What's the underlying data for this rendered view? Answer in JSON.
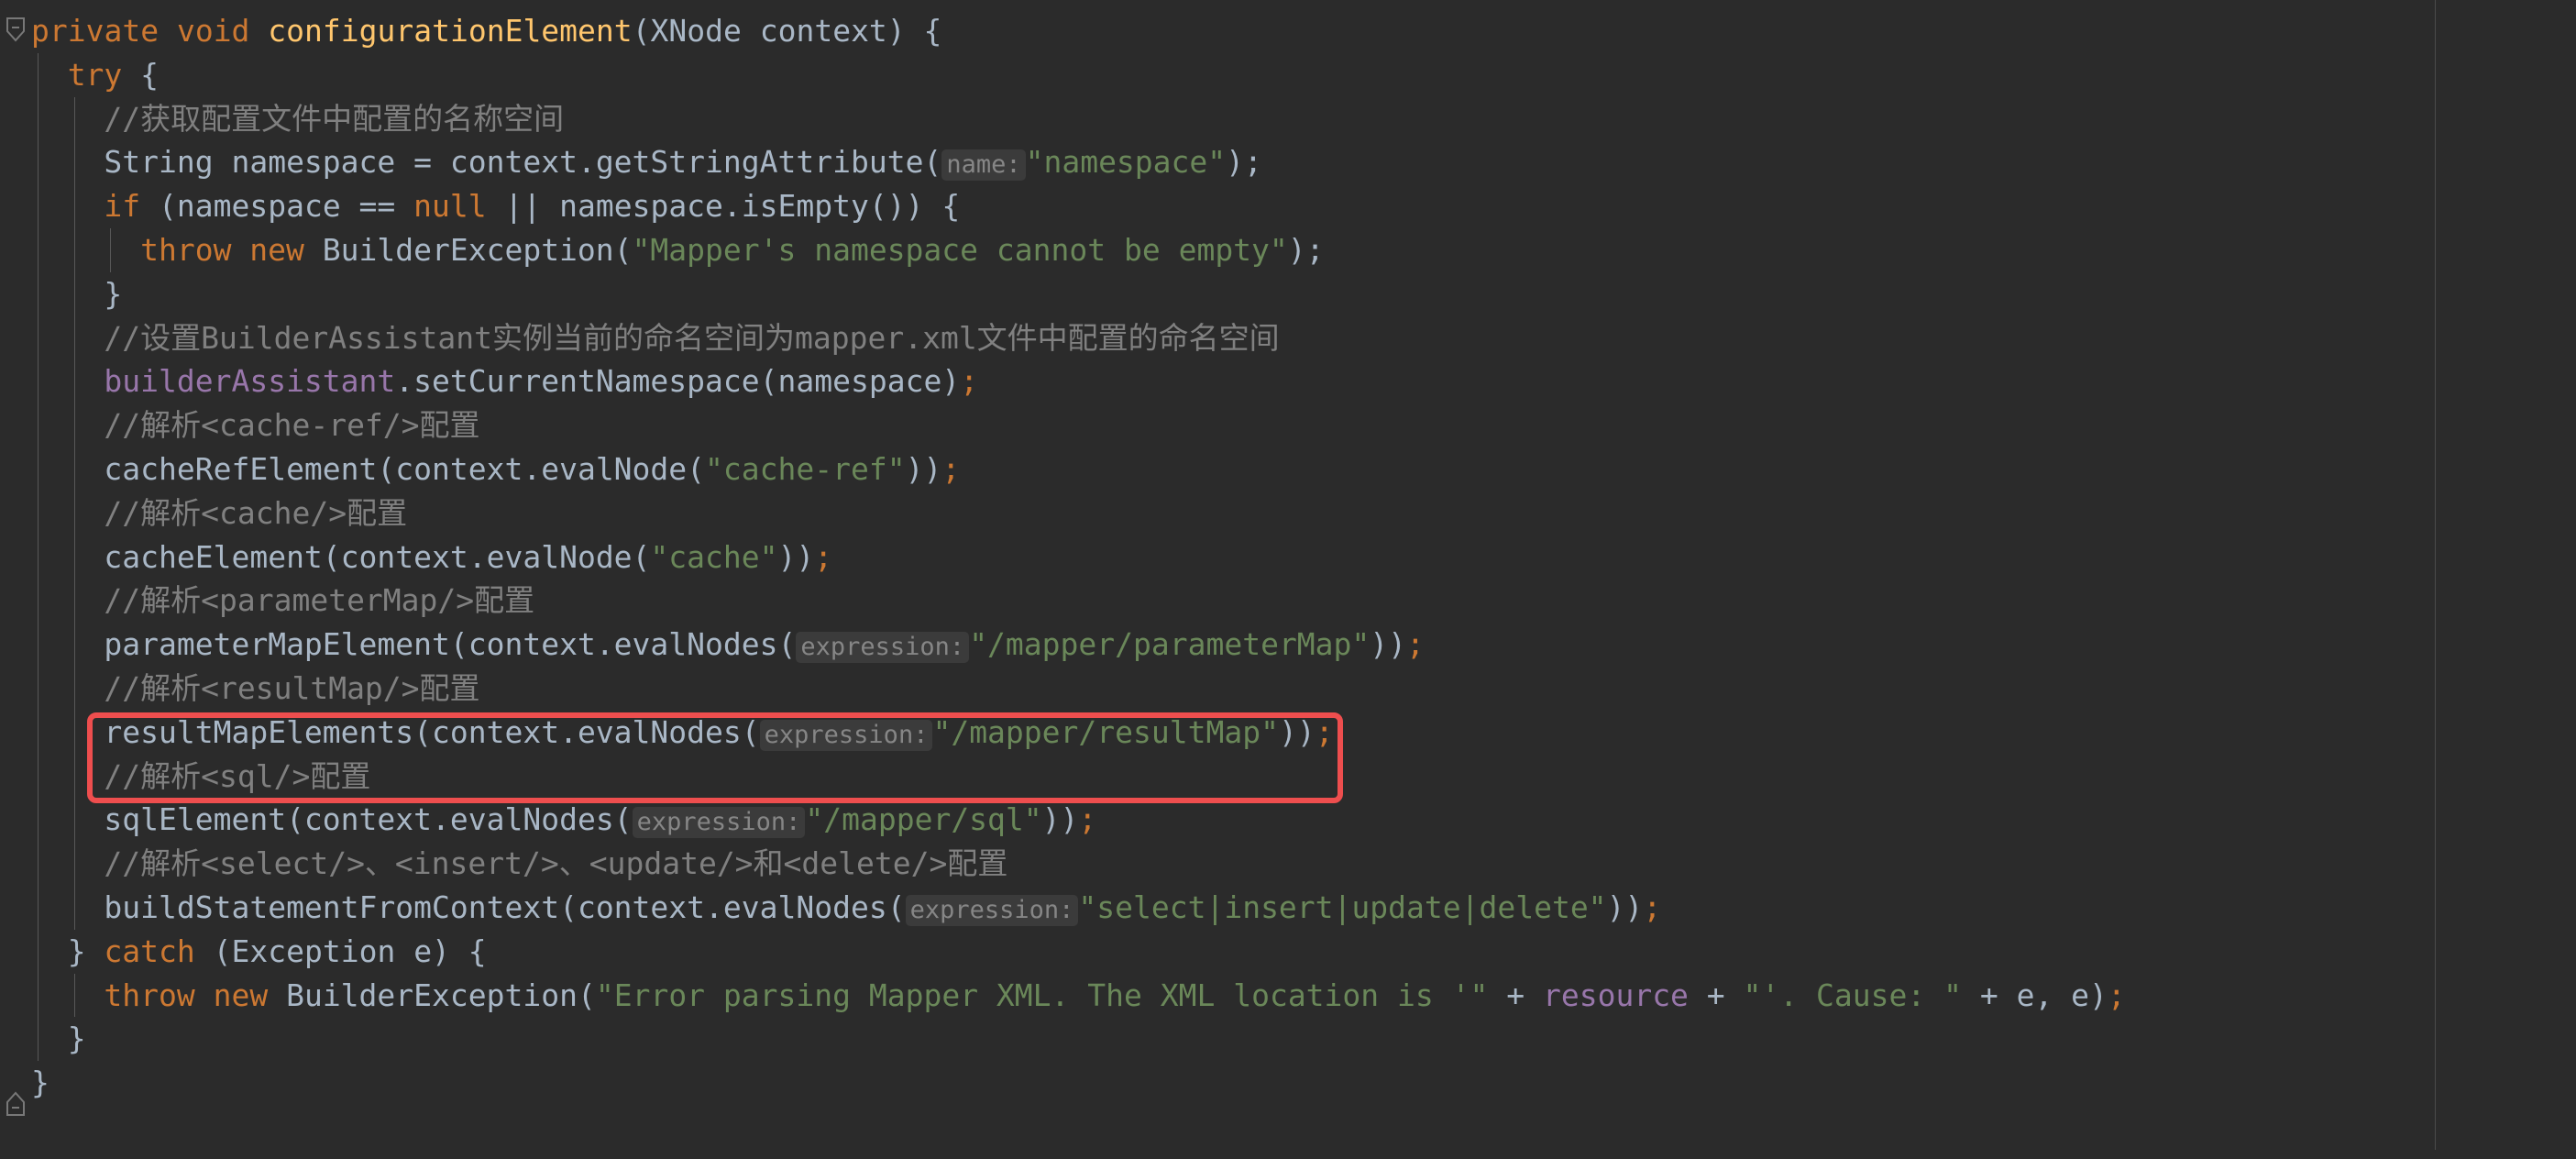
{
  "editor": {
    "theme_background": "#2b2b2b",
    "gutter_background": "#2b2b2b",
    "font_size_px": 33,
    "line_height_px": 47.8,
    "right_margin_column_guide": true,
    "colors": {
      "keyword": "#cc7832",
      "identifier": "#a9b7c6",
      "method_declaration": "#ffc66d",
      "string": "#6a8759",
      "comment": "#808080",
      "field": "#9876aa",
      "parameter_hint_text": "#868686",
      "parameter_hint_background": "#3b3b3b",
      "annotation_box": "#ee4e4e",
      "indent_guide": "#585858"
    }
  },
  "gutter": {
    "markers": [
      {
        "name": "fold-region-start",
        "glyph": "fold-open-bracket"
      },
      {
        "name": "fold-region-end",
        "glyph": "fold-close-bracket"
      }
    ]
  },
  "annotation": {
    "type": "rectangle-highlight",
    "color": "#ee4e4e",
    "target_lines": [
      "//解析<sql/>配置",
      "sqlElement(context.evalNodes( expression: \"/mapper/sql\"));"
    ]
  },
  "code": {
    "language": "Java",
    "lines": [
      {
        "indent": 0,
        "guides": [],
        "tokens": [
          {
            "t": "kw",
            "v": "private "
          },
          {
            "t": "kw",
            "v": "void "
          },
          {
            "t": "mname",
            "v": "configurationElement"
          },
          {
            "t": "plain",
            "v": "(XNode context) {"
          }
        ]
      },
      {
        "indent": 1,
        "guides": [
          1
        ],
        "tokens": [
          {
            "t": "kw",
            "v": "try"
          },
          {
            "t": "plain",
            "v": " {"
          }
        ]
      },
      {
        "indent": 2,
        "guides": [
          1,
          2
        ],
        "tokens": [
          {
            "t": "cmt",
            "v": "//获取配置文件中配置的名称空间"
          }
        ]
      },
      {
        "indent": 2,
        "guides": [
          1,
          2
        ],
        "tokens": [
          {
            "t": "plain",
            "v": "String namespace = context.getStringAttribute("
          },
          {
            "t": "hint",
            "v": "name:"
          },
          {
            "t": "str",
            "v": "\"namespace\""
          },
          {
            "t": "plain",
            "v": ");"
          }
        ]
      },
      {
        "indent": 2,
        "guides": [
          1,
          2
        ],
        "tokens": [
          {
            "t": "kw",
            "v": "if"
          },
          {
            "t": "plain",
            "v": " (namespace == "
          },
          {
            "t": "kw",
            "v": "null"
          },
          {
            "t": "plain",
            "v": " || namespace.isEmpty()) {"
          }
        ]
      },
      {
        "indent": 3,
        "guides": [
          1,
          2,
          3
        ],
        "tokens": [
          {
            "t": "kw",
            "v": "throw new "
          },
          {
            "t": "plain",
            "v": "BuilderException("
          },
          {
            "t": "str",
            "v": "\"Mapper's namespace cannot be empty\""
          },
          {
            "t": "plain",
            "v": ");"
          }
        ]
      },
      {
        "indent": 2,
        "guides": [
          1,
          2
        ],
        "tokens": [
          {
            "t": "plain",
            "v": "}"
          }
        ]
      },
      {
        "indent": 2,
        "guides": [
          1,
          2
        ],
        "tokens": [
          {
            "t": "cmt",
            "v": "//设置BuilderAssistant实例当前的命名空间为mapper.xml文件中配置的命名空间"
          }
        ]
      },
      {
        "indent": 2,
        "guides": [
          1,
          2
        ],
        "tokens": [
          {
            "t": "field",
            "v": "builderAssistant"
          },
          {
            "t": "plain",
            "v": ".setCurrentNamespace(namespace)"
          },
          {
            "t": "kw",
            "v": ";"
          }
        ]
      },
      {
        "indent": 2,
        "guides": [
          1,
          2
        ],
        "tokens": [
          {
            "t": "cmt",
            "v": "//解析<cache-ref/>配置"
          }
        ]
      },
      {
        "indent": 2,
        "guides": [
          1,
          2
        ],
        "tokens": [
          {
            "t": "plain",
            "v": "cacheRefElement(context.evalNode("
          },
          {
            "t": "str",
            "v": "\"cache-ref\""
          },
          {
            "t": "plain",
            "v": "))"
          },
          {
            "t": "kw",
            "v": ";"
          }
        ]
      },
      {
        "indent": 2,
        "guides": [
          1,
          2
        ],
        "tokens": [
          {
            "t": "cmt",
            "v": "//解析<cache/>配置"
          }
        ]
      },
      {
        "indent": 2,
        "guides": [
          1,
          2
        ],
        "tokens": [
          {
            "t": "plain",
            "v": "cacheElement(context.evalNode("
          },
          {
            "t": "str",
            "v": "\"cache\""
          },
          {
            "t": "plain",
            "v": "))"
          },
          {
            "t": "kw",
            "v": ";"
          }
        ]
      },
      {
        "indent": 2,
        "guides": [
          1,
          2
        ],
        "tokens": [
          {
            "t": "cmt",
            "v": "//解析<parameterMap/>配置"
          }
        ]
      },
      {
        "indent": 2,
        "guides": [
          1,
          2
        ],
        "tokens": [
          {
            "t": "plain",
            "v": "parameterMapElement(context.evalNodes("
          },
          {
            "t": "hint",
            "v": "expression:"
          },
          {
            "t": "str",
            "v": "\"/mapper/parameterMap\""
          },
          {
            "t": "plain",
            "v": "))"
          },
          {
            "t": "kw",
            "v": ";"
          }
        ]
      },
      {
        "indent": 2,
        "guides": [
          1,
          2
        ],
        "tokens": [
          {
            "t": "cmt",
            "v": "//解析<resultMap/>配置"
          }
        ]
      },
      {
        "indent": 2,
        "guides": [
          1,
          2
        ],
        "tokens": [
          {
            "t": "plain",
            "v": "resultMapElements(context.evalNodes("
          },
          {
            "t": "hint",
            "v": "expression:"
          },
          {
            "t": "str",
            "v": "\"/mapper/resultMap\""
          },
          {
            "t": "plain",
            "v": "))"
          },
          {
            "t": "kw",
            "v": ";"
          }
        ]
      },
      {
        "indent": 2,
        "guides": [
          1,
          2
        ],
        "tokens": [
          {
            "t": "cmt",
            "v": "//解析<sql/>配置"
          }
        ]
      },
      {
        "indent": 2,
        "guides": [
          1,
          2
        ],
        "tokens": [
          {
            "t": "plain",
            "v": "sqlElement(context.evalNodes("
          },
          {
            "t": "hint",
            "v": "expression:"
          },
          {
            "t": "str",
            "v": "\"/mapper/sql\""
          },
          {
            "t": "plain",
            "v": "))"
          },
          {
            "t": "kw",
            "v": ";"
          }
        ]
      },
      {
        "indent": 2,
        "guides": [
          1,
          2
        ],
        "tokens": [
          {
            "t": "cmt",
            "v": "//解析<select/>、<insert/>、<update/>和<delete/>配置"
          }
        ]
      },
      {
        "indent": 2,
        "guides": [
          1,
          2
        ],
        "tokens": [
          {
            "t": "plain",
            "v": "buildStatementFromContext(context.evalNodes("
          },
          {
            "t": "hint",
            "v": "expression:"
          },
          {
            "t": "str",
            "v": "\"select|insert|update|delete\""
          },
          {
            "t": "plain",
            "v": "))"
          },
          {
            "t": "kw",
            "v": ";"
          }
        ]
      },
      {
        "indent": 1,
        "guides": [
          1
        ],
        "tokens": [
          {
            "t": "plain",
            "v": "} "
          },
          {
            "t": "kw",
            "v": "catch"
          },
          {
            "t": "plain",
            "v": " (Exception e) {"
          }
        ]
      },
      {
        "indent": 2,
        "guides": [
          1,
          2
        ],
        "tokens": [
          {
            "t": "kw",
            "v": "throw new "
          },
          {
            "t": "plain",
            "v": "BuilderException("
          },
          {
            "t": "str",
            "v": "\"Error parsing Mapper XML. The XML location is '\""
          },
          {
            "t": "plain",
            "v": " + "
          },
          {
            "t": "field",
            "v": "resource"
          },
          {
            "t": "plain",
            "v": " + "
          },
          {
            "t": "str",
            "v": "\"'. Cause: \""
          },
          {
            "t": "plain",
            "v": " + e, e)"
          },
          {
            "t": "kw",
            "v": ";"
          }
        ]
      },
      {
        "indent": 1,
        "guides": [
          1
        ],
        "tokens": [
          {
            "t": "plain",
            "v": "}"
          }
        ]
      },
      {
        "indent": 0,
        "guides": [],
        "tokens": [
          {
            "t": "plain",
            "v": "}"
          }
        ]
      }
    ]
  }
}
